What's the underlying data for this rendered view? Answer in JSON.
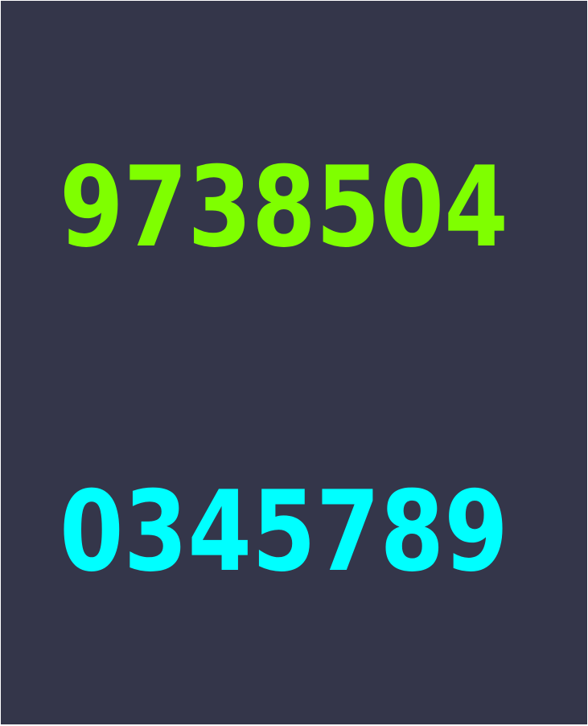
{
  "rows": {
    "top": {
      "digits": "9738504",
      "color": "#7fff00"
    },
    "bottom": {
      "digits": "0345789",
      "color": "#00ffff"
    }
  },
  "background": "#34364a"
}
